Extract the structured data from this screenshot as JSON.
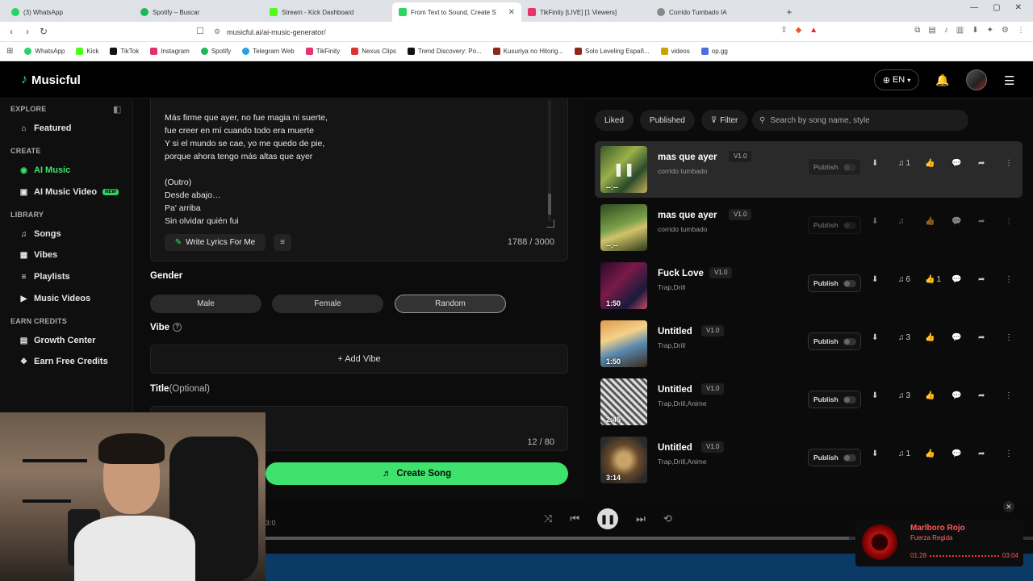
{
  "browser": {
    "tabs": [
      {
        "label": "(3) WhatsApp",
        "color": "#25d366"
      },
      {
        "label": "Spotify – Buscar",
        "color": "#1db954"
      },
      {
        "label": "Stream - Kick Dashboard",
        "color": "#53fc18"
      },
      {
        "label": "From Text to Sound, Create S",
        "color": "#2fd361"
      },
      {
        "label": "TikFinity [LIVE] [1 Viewers]",
        "color": "#e8336d"
      },
      {
        "label": "Corrido Tumbado IA",
        "color": "#888888"
      }
    ],
    "url": "musicful.ai/ai-music-generator/",
    "bookmarks": [
      {
        "label": "WhatsApp",
        "color": "#25d366"
      },
      {
        "label": "Kick",
        "color": "#53fc18"
      },
      {
        "label": "TikTok",
        "color": "#111111"
      },
      {
        "label": "Instagram",
        "color": "#e1306c"
      },
      {
        "label": "Spotify",
        "color": "#1db954"
      },
      {
        "label": "Telegram Web",
        "color": "#2aa1da"
      },
      {
        "label": "TikFinity",
        "color": "#e8336d"
      },
      {
        "label": "Nexus Clips",
        "color": "#d33"
      },
      {
        "label": "Trend Discovery: Po...",
        "color": "#111111"
      },
      {
        "label": "Kusuriya no Hitorig...",
        "color": "#8a2a1a"
      },
      {
        "label": "Solo Leveling Españ...",
        "color": "#8a2a1a"
      },
      {
        "label": "videos",
        "color": "#c9a200"
      },
      {
        "label": "op.gg",
        "color": "#4a6ee0"
      }
    ]
  },
  "app": {
    "logo": "Musicful",
    "lang": "EN",
    "sidebar": {
      "explore": "EXPLORE",
      "featured": "Featured",
      "create": "CREATE",
      "ai_music": "AI Music",
      "ai_video": "AI Music Video",
      "new_badge": "NEW",
      "library": "LIBRARY",
      "songs": "Songs",
      "vibes": "Vibes",
      "playlists": "Playlists",
      "music_videos": "Music Videos",
      "earn": "EARN CREDITS",
      "growth": "Growth Center",
      "free_credits": "Earn Free Credits"
    },
    "lyrics": "Más firme que ayer, no fue magia ni suerte,\nfue creer en mí cuando todo era muerte\nY si el mundo se cae, yo me quedo de pie,\nporque ahora tengo más altas que ayer\n\n(Outro)\nDesde abajo…\nPa' arriba\nSin olvidar quién fui",
    "write_lyrics": "Write Lyrics For Me",
    "lyrics_count": "1788 / 3000",
    "gender_label": "Gender",
    "gender": {
      "male": "Male",
      "female": "Female",
      "random": "Random"
    },
    "vibe_label": "Vibe",
    "add_vibe": "+ Add Vibe",
    "title_label": "Title",
    "title_optional": "(Optional)",
    "title_count": "12 / 80",
    "create_song": "Create Song",
    "filters": {
      "liked": "Liked",
      "published": "Published",
      "filter": "Filter"
    },
    "search_placeholder": "Search by song name, style",
    "publish": "Publish",
    "songs": [
      {
        "title": "mas que ayer",
        "version": "V1.0",
        "style": "corrido tumbado",
        "duration": "--:--",
        "plays": "1",
        "likes": "",
        "bg": "linear-gradient(135deg,#3a5a2a,#9ab04a 40%,#2a4a2a 70%,#c9b25a)"
      },
      {
        "title": "mas que ayer",
        "version": "V1.0",
        "style": "corrido tumbado",
        "duration": "--:--",
        "plays": "",
        "likes": "",
        "bg": "linear-gradient(160deg,#2e4a1e,#7aa04a 45%,#d2c36a 60%,#2a3a1a)"
      },
      {
        "title": "Fuck Love",
        "version": "V1.0",
        "style": "Trap,Drill",
        "duration": "1:50",
        "plays": "6",
        "likes": "1",
        "bg": "linear-gradient(135deg,#2a0a2a,#7a1a4a 40%,#1a1a3a 75%,#c84a6a)"
      },
      {
        "title": "Untitled",
        "version": "V1.0",
        "style": "Trap,Drill",
        "duration": "1:50",
        "plays": "3",
        "likes": "",
        "bg": "linear-gradient(160deg,#e09a4a,#f4d28a 35%,#5a8ab0 60%,#3a2a1a)"
      },
      {
        "title": "Untitled",
        "version": "V1.0",
        "style": "Trap,Drill,Anime",
        "duration": "2:45",
        "plays": "3",
        "likes": "",
        "bg": "repeating-linear-gradient(45deg,#ddd 0 3px,#555 3px 6px)"
      },
      {
        "title": "Untitled",
        "version": "V1.0",
        "style": "Trap,Drill,Anime",
        "duration": "3:14",
        "plays": "1",
        "likes": "",
        "bg": "radial-gradient(circle,#c8a46a 20%,#6a4a2a 45%,#2a2a2a 80%)"
      }
    ],
    "player": {
      "time_left": "3:0"
    },
    "now_playing": {
      "song": "Marlboro Rojo",
      "artist": "Fuerza Regida",
      "elapsed": "01:28",
      "total": "03:04"
    }
  }
}
